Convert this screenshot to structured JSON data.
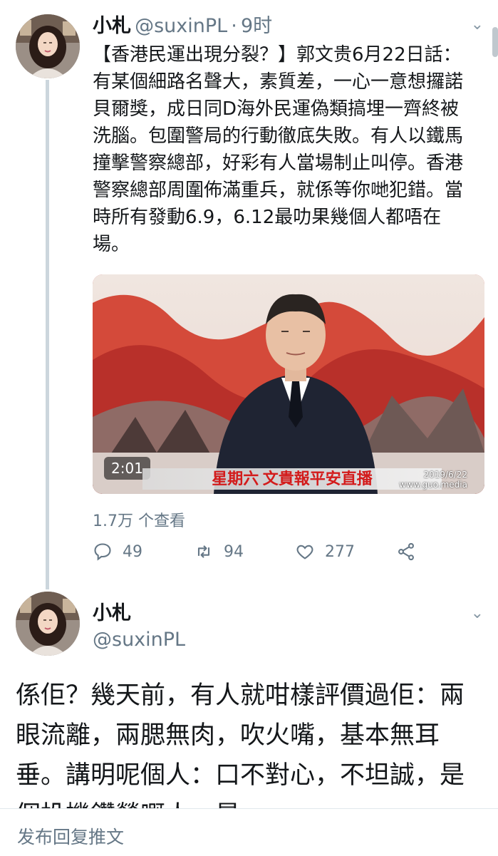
{
  "tweet1": {
    "display_name": "小札",
    "handle": "@suxinPL",
    "separator": "·",
    "time": "9时",
    "text": "【香港民運出現分裂？】郭文贵6月22日話：有某個細路名聲大，素質差，一心一意想攞諾貝爾獎，成日同D海外民運偽類搞埋一齊終被洗腦。包圍警局的行動徹底失敗。有人以鐵馬撞擊警察總部，好彩有人當場制止叫停。香港警察總部周圍佈滿重兵，就係等你哋犯錯。當時所有發動6.9，6.12最叻果幾個人都唔在場。",
    "video": {
      "duration": "2:01",
      "caption": "星期六 文貴報平安直播",
      "date_tag": "2019/6/22",
      "site_tag": "www.guo.media"
    },
    "views": "1.7万 个查看",
    "actions": {
      "reply_count": "49",
      "retweet_count": "94",
      "like_count": "277"
    },
    "icons": [
      "reply-icon",
      "retweet-icon",
      "like-icon",
      "share-icon",
      "chevron-down-icon"
    ]
  },
  "tweet2": {
    "display_name": "小札",
    "handle": "@suxinPL",
    "text": "係佢？幾天前，有人就咁樣評價過佢：兩眼流離，兩腮無肉，吹火嘴，基本無耳垂。講明呢個人：口不對心，不坦誠，是個投機鑽營嘅人，是"
  },
  "reply_bar": {
    "placeholder": "发布回复推文"
  },
  "colors": {
    "text": "#14171a",
    "secondary": "#657786",
    "thread_line": "#ccd6dd"
  }
}
